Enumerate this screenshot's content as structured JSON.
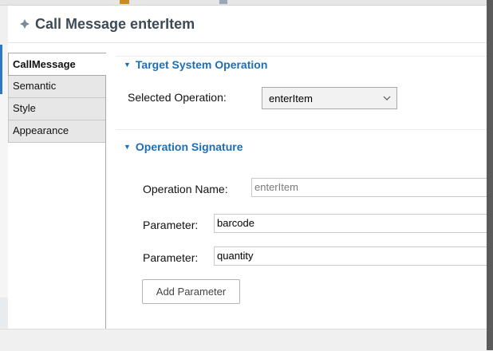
{
  "header": {
    "title": "Call Message enterItem"
  },
  "tabs": [
    {
      "label": "CallMessage"
    },
    {
      "label": "Semantic"
    },
    {
      "label": "Style"
    },
    {
      "label": "Appearance"
    }
  ],
  "target_section": {
    "title": "Target System Operation",
    "selected_operation_label": "Selected Operation:",
    "selected_operation_value": "enterItem"
  },
  "signature_section": {
    "title": "Operation Signature",
    "operation_name_label": "Operation Name:",
    "operation_name_value": "enterItem",
    "parameters": [
      {
        "label": "Parameter:",
        "value": "barcode"
      },
      {
        "label": "Parameter:",
        "value": "quantity"
      }
    ],
    "add_parameter_label": "Add Parameter"
  },
  "colors": {
    "section_title": "#1c6fb5",
    "header_title": "#3f4a57",
    "accent": "#2b79c2"
  }
}
